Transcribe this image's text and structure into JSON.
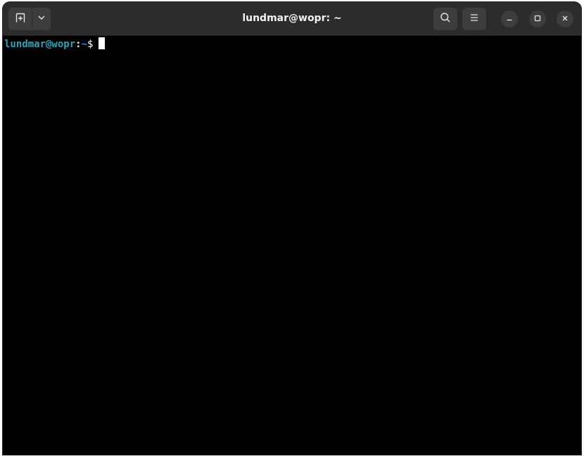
{
  "window": {
    "title": "lundmar@wopr: ~"
  },
  "headerbar": {
    "new_tab_icon": "new-tab-icon",
    "tab_menu_icon": "chevron-down-icon",
    "search_icon": "search-icon",
    "menu_icon": "hamburger-menu-icon",
    "minimize_icon": "minimize-icon",
    "maximize_icon": "maximize-icon",
    "close_icon": "close-icon"
  },
  "terminal": {
    "prompt_user_host": "lundmar@wopr",
    "prompt_separator": ":",
    "prompt_path": "~",
    "prompt_symbol": "$"
  },
  "colors": {
    "headerbar_bg": "#2c2c2c",
    "button_bg": "#3d3d3d",
    "terminal_bg": "#000000",
    "prompt_user_color": "#26a5b8",
    "prompt_path_color": "#3a7fd6"
  }
}
